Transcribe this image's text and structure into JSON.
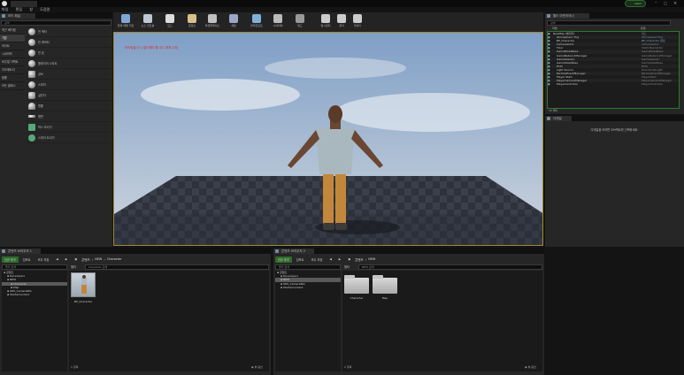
{
  "window": {
    "title_tab": "",
    "user_badge": "rwhd"
  },
  "menu": [
    "파일",
    "편집",
    "창",
    "도움말"
  ],
  "modes_panel": {
    "tab_label": "모드 패널",
    "search_placeholder": "검색",
    "categories": [
      "최근 배치됨",
      "기본",
      "라이트",
      "시네마틱",
      "비주얼 이펙트",
      "지오메트리",
      "볼륨",
      "모든 클래스"
    ],
    "active_category": 1,
    "items": [
      "빈 액터",
      "빈 캐릭터",
      "빈 폰",
      "플레이어 스타트",
      "큐브",
      "스피어",
      "실린더",
      "원뿔",
      "평면",
      "박스 트리거",
      "스피어 트리거"
    ]
  },
  "toolbar": {
    "buttons": [
      {
        "label": "현재 레벨 저장",
        "icon": "save-icon"
      },
      {
        "label": "소스 컨트롤",
        "icon": "source-control-icon"
      },
      {
        "label": "모드",
        "icon": "modes-icon"
      },
      {
        "label": "콘텐츠",
        "icon": "content-icon"
      },
      {
        "label": "마켓플레이스",
        "icon": "marketplace-icon"
      },
      {
        "label": "세팅",
        "icon": "settings-icon"
      },
      {
        "label": "블루프린트",
        "icon": "blueprint-icon"
      },
      {
        "label": "시네마틱",
        "icon": "cinematics-icon"
      },
      {
        "label": "빌드",
        "icon": "build-icon"
      },
      {
        "label": "일시정지",
        "icon": "pause-icon"
      },
      {
        "label": "정지",
        "icon": "stop-icon"
      },
      {
        "label": "꺼내기",
        "icon": "eject-icon"
      }
    ]
  },
  "viewport": {
    "warning_text": "라이팅을 다시 빌드해야 합니다 (개체 1개)",
    "colors": {
      "sky_top": "#8aa6c9",
      "sky_bottom": "#c9d2dc",
      "floor": "#3a3f4a",
      "shirt": "#a9b8bf",
      "pants": "#c2873b",
      "skin": "#6b4632"
    }
  },
  "outliner": {
    "tab_label": "월드 아웃라이너",
    "search_placeholder": "검색",
    "col_label": "라벨",
    "col_type": "유형",
    "rows": [
      {
        "name": "NewMap (에디터)",
        "type": "월드"
      },
      {
        "name": "Atmospheric Fog",
        "type": "AtmosphericFog"
      },
      {
        "name": "BP_Character",
        "type": "BP_Character 편집"
      },
      {
        "name": "CameraActor",
        "type": "CameraActor"
      },
      {
        "name": "Floor",
        "type": "StaticMeshActor"
      },
      {
        "name": "GameModeBase",
        "type": "GameModeBase"
      },
      {
        "name": "GameNetworkManager",
        "type": "GameNetworkManager"
      },
      {
        "name": "GameSession",
        "type": "GameSession"
      },
      {
        "name": "GameStateBase",
        "type": "GameStateBase"
      },
      {
        "name": "HUD",
        "type": "HUD"
      },
      {
        "name": "Light Source",
        "type": "DirectionalLight"
      },
      {
        "name": "ParticleEventManager",
        "type": "ParticleEventManager"
      },
      {
        "name": "Player Start",
        "type": "PlayerStart"
      },
      {
        "name": "PlayerCameraManager",
        "type": "PlayerCameraManager"
      },
      {
        "name": "PlayerController",
        "type": "PlayerController"
      }
    ],
    "footer": "15 액터"
  },
  "details": {
    "tab_label": "디테일",
    "empty_text": "디테일을 보려면 오브젝트를 선택하세요."
  },
  "cb1": {
    "tab_label": "콘텐츠 브라우저 1",
    "add_new": "신규 추가",
    "import": "임포트",
    "save_all": "모두 저장",
    "path": [
      "콘텐츠",
      "NEW",
      "Character"
    ],
    "search_folders": "폴더 검색",
    "filter": "필터",
    "search_assets": "Character 검색",
    "tree": [
      "콘텐츠",
      "Developers",
      "NEW",
      "Character",
      "Map",
      "SDK_CameraRIG",
      "StarterContent"
    ],
    "tree_selected": 3,
    "asset": "BP_Character",
    "count": "1 항목",
    "view_options": "뷰 옵션"
  },
  "cb2": {
    "tab_label": "콘텐츠 브라우저 2",
    "add_new": "신규 추가",
    "import": "임포트",
    "save_all": "모두 저장",
    "path": [
      "콘텐츠",
      "NEW"
    ],
    "search_folders": "폴더 검색",
    "filter": "필터",
    "search_assets": "NEW 검색",
    "tree": [
      "콘텐츠",
      "Developers",
      "NEW",
      "SDK_CameraRIG",
      "StarterContent"
    ],
    "tree_selected": 2,
    "folders": [
      "Character",
      "Map"
    ],
    "count": "2 항목",
    "view_options": "뷰 옵션"
  }
}
